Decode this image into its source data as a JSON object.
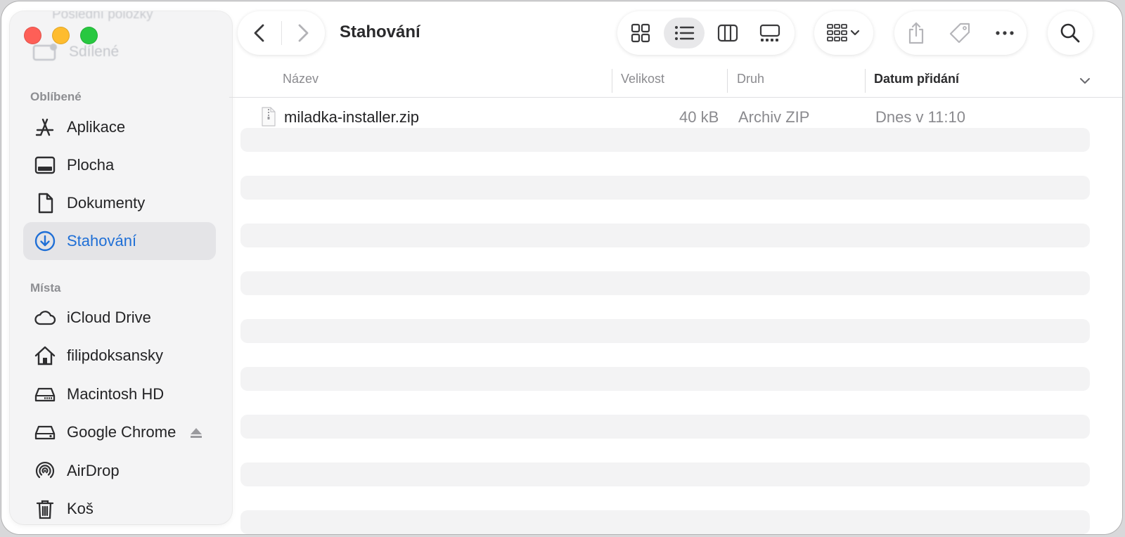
{
  "window": {
    "title": "Stahování"
  },
  "sidebar": {
    "ghost_items": [
      {
        "label": "Sdílené",
        "icon": "shared-folder-icon"
      }
    ],
    "ghost_top": "Poslední položky",
    "sections": [
      {
        "title": "Oblíbené",
        "items": [
          {
            "label": "Aplikace",
            "icon": "applications-icon"
          },
          {
            "label": "Plocha",
            "icon": "desktop-icon"
          },
          {
            "label": "Dokumenty",
            "icon": "document-icon"
          },
          {
            "label": "Stahování",
            "icon": "download-icon",
            "active": true
          }
        ]
      },
      {
        "title": "Místa",
        "items": [
          {
            "label": "iCloud Drive",
            "icon": "cloud-icon"
          },
          {
            "label": "filipdoksansky",
            "icon": "home-icon"
          },
          {
            "label": "Macintosh HD",
            "icon": "disk-icon"
          },
          {
            "label": "Google Chrome",
            "icon": "disk-icon",
            "ejectable": true
          },
          {
            "label": "AirDrop",
            "icon": "airdrop-icon"
          },
          {
            "label": "Koš",
            "icon": "trash-icon"
          }
        ]
      }
    ]
  },
  "toolbar": {
    "view_modes": [
      "icon-view-icon",
      "list-view-icon",
      "column-view-icon",
      "gallery-view-icon"
    ],
    "active_view": "list-view-icon"
  },
  "table": {
    "columns": [
      {
        "label": "Název"
      },
      {
        "label": "Velikost"
      },
      {
        "label": "Druh"
      },
      {
        "label": "Datum přidání",
        "sorted": true
      }
    ],
    "rows": [
      {
        "name": "miladka-installer.zip",
        "size": "40 kB",
        "kind": "Archiv ZIP",
        "date_added": "Dnes v 11:10"
      }
    ]
  },
  "colors": {
    "accent": "#1f6fd6",
    "traffic_red": "#fe5f57",
    "traffic_yellow": "#febc2e",
    "traffic_green": "#28c840"
  }
}
